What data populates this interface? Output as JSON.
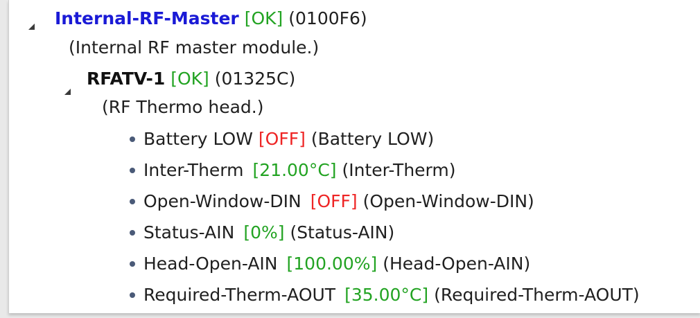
{
  "tree": {
    "master": {
      "name": "Internal-RF-Master",
      "status": "[OK]",
      "id": "(0100F6)",
      "description": "(Internal RF master module.)",
      "expander_icon": "expanded-triangle-icon"
    },
    "device": {
      "name": "RFATV-1",
      "status": "[OK]",
      "id": "(01325C)",
      "description": "(RF Thermo head.)",
      "expander_icon": "expanded-triangle-icon"
    },
    "channels": [
      {
        "name": "Battery LOW",
        "value": "[OFF]",
        "label": "(Battery LOW)",
        "value_color": "#ee2424"
      },
      {
        "name": "Inter-Therm",
        "value": "[21.00°C]",
        "label": "(Inter-Therm)",
        "value_color": "#22a322"
      },
      {
        "name": "Open-Window-DIN",
        "value": "[OFF]",
        "label": "(Open-Window-DIN)",
        "value_color": "#ee2424"
      },
      {
        "name": "Status-AIN",
        "value": "[0%]",
        "label": "(Status-AIN)",
        "value_color": "#22a322"
      },
      {
        "name": "Head-Open-AIN",
        "value": "[100.00%]",
        "label": "(Head-Open-AIN)",
        "value_color": "#22a322"
      },
      {
        "name": "Required-Therm-AOUT",
        "value": "[35.00°C]",
        "label": "(Required-Therm-AOUT)",
        "value_color": "#22a322"
      }
    ],
    "bullet_icon": "bullet-icon",
    "colors": {
      "master_name": "#1a1ad6",
      "ok_status": "#22a322",
      "off_status": "#ee2424"
    }
  }
}
